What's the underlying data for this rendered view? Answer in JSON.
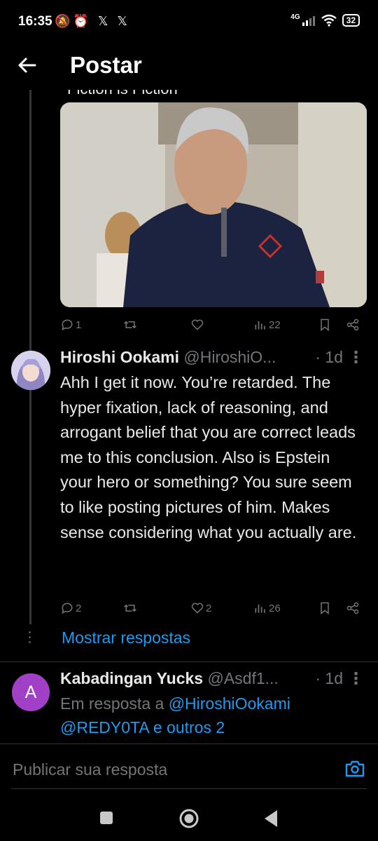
{
  "status_bar": {
    "time": "16:35",
    "icons": "🔕⏰ 𝕏 𝕏",
    "network": "4G",
    "battery": "32"
  },
  "header": {
    "title": "Postar"
  },
  "prev_tweet": {
    "cut_text": "Fiction is Fiction",
    "actions": {
      "replies": "1",
      "retweets": "",
      "likes": "",
      "views": "22"
    }
  },
  "tweet": {
    "name": "Hiroshi Ookami",
    "handle": "@HiroshiO...",
    "time": "· 1d",
    "body": "Ahh I get it now. You’re retarded. The hyper fixation, lack of reasoning, and arrogant belief that you are correct leads me to this conclusion. Also is Epstein your hero or something? You sure seem to like posting pictures of him. Makes sense considering what you actually are.",
    "actions": {
      "replies": "2",
      "retweets": "",
      "likes": "2",
      "views": "26"
    }
  },
  "show_replies": "Mostrar respostas",
  "reply_tweet": {
    "avatar_letter": "A",
    "name": "Kabadingan Yucks",
    "handle": "@Asdf1...",
    "time": "· 1d",
    "reply_prefix": "Em resposta a",
    "mention1": "@HiroshiOokami",
    "mention2": "@REDY0TA",
    "reply_suffix": "e outros 2"
  },
  "composer": {
    "placeholder": "Publicar sua resposta"
  },
  "colors": {
    "accent": "#1d9bf0",
    "muted": "#71767b",
    "avatar_purple": "#a23fc7"
  }
}
